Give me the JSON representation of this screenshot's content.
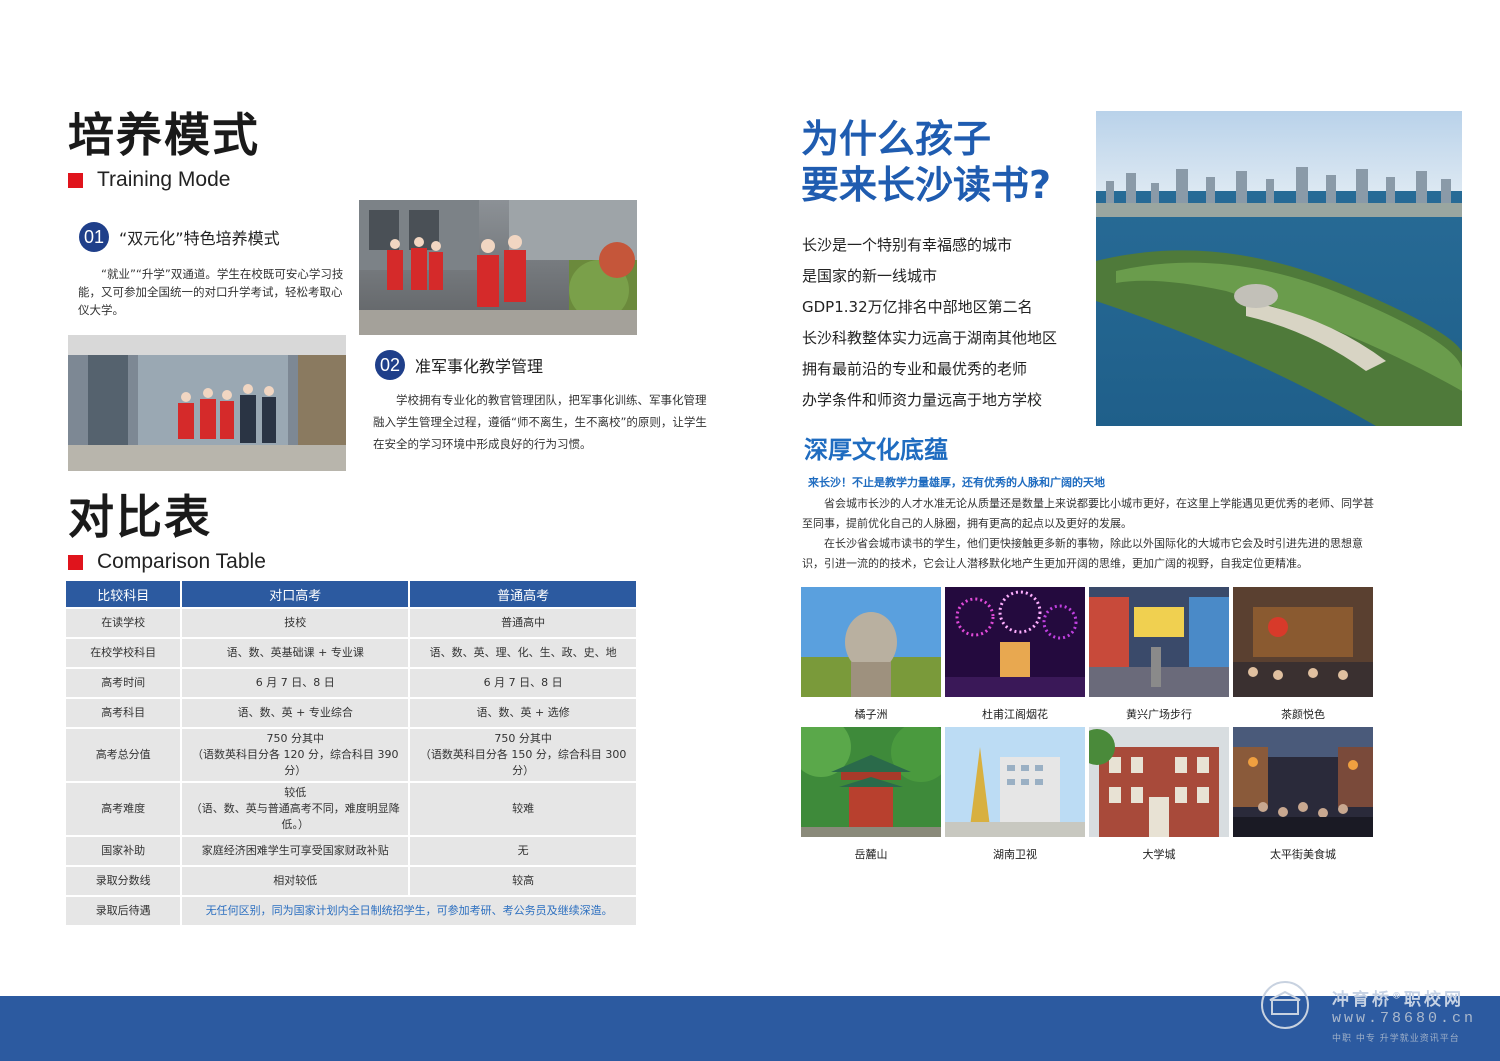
{
  "training": {
    "title": "培养模式",
    "subtitle": "Training Mode",
    "item1": {
      "num": "01",
      "title": "“双元化”特色培养模式",
      "text": "“就业”“升学”双通道。学生在校既可安心学习技能，又可参加全国统一的对口升学考试，轻松考取心仪大学。"
    },
    "item2": {
      "num": "02",
      "title": "准军事化教学管理",
      "text": "学校拥有专业化的教官管理团队，把军事化训练、军事化管理融入学生管理全过程，遵循“师不离生，生不离校”的原则，让学生在安全的学习环境中形成良好的行为习惯。"
    }
  },
  "comparison": {
    "title": "对比表",
    "subtitle": "Comparison Table",
    "headers": [
      "比较科目",
      "对口高考",
      "普通高考"
    ],
    "rows": [
      [
        "在读学校",
        "技校",
        "普通高中"
      ],
      [
        "在校学校科目",
        "语、数、英基础课 + 专业课",
        "语、数、英、理、化、生、政、史、地"
      ],
      [
        "高考时间",
        "6 月 7 日、8 日",
        "6 月 7 日、8 日"
      ],
      [
        "高考科目",
        "语、数、英 + 专业综合",
        "语、数、英 + 选修"
      ],
      [
        "高考总分值",
        "750 分其中\n（语数英科目分各 120 分，综合科目 390 分）",
        "750 分其中\n（语数英科目分各 150 分，综合科目 300 分）"
      ],
      [
        "高考难度",
        "较低\n（语、数、英与普通高考不同，难度明显降低。）",
        "较难"
      ],
      [
        "国家补助",
        "家庭经济困难学生可享受国家财政补贴",
        "无"
      ],
      [
        "录取分数线",
        "相对较低",
        "较高"
      ]
    ],
    "last_row": {
      "label": "录取后待遇",
      "text": "无任何区别，同为国家计划内全日制统招学生，可参加考研、考公务员及继续深造。"
    }
  },
  "why": {
    "title_line1": "为什么孩子",
    "title_line2": "要来长沙读书?",
    "lines": [
      "长沙是一个特别有幸福感的城市",
      "是国家的新一线城市",
      "GDP1.32万亿排名中部地区第二名",
      "长沙科教整体实力远高于湖南其他地区",
      "拥有最前沿的专业和最优秀的老师",
      "办学条件和师资力量远高于地方学校"
    ]
  },
  "culture": {
    "title": "深厚文化底蕴",
    "subtitle": "来长沙！不止是教学力量雄厚，还有优秀的人脉和广阔的天地",
    "para1": "省会城市长沙的人才水准无论从质量还是数量上来说都要比小城市更好，在这里上学能遇见更优秀的老师、同学甚至同事，提前优化自己的人脉圈，拥有更高的起点以及更好的发展。",
    "para2": "在长沙省会城市读书的学生，他们更快接触更多新的事物，除此以外国际化的大城市它会及时引进先进的思想意识，引进一流的的技术，它会让人潜移默化地产生更加开阔的思维，更加广阔的视野，自我定位更精准。"
  },
  "gallery": [
    "橘子洲",
    "杜甫江阁烟花",
    "黄兴广场步行",
    "茶颜悦色",
    "岳麓山",
    "湖南卫视",
    "大学城",
    "太平街美食城"
  ],
  "watermark": {
    "name": "冲育桥",
    "reg": "®",
    "name2": "职校网",
    "url": "www.78680.cn",
    "tagline": "中职 中专 升学就业资讯平台"
  },
  "colors": {
    "navy": "#1f3f8a",
    "blue": "#2c5aa0",
    "title_blue": "#1f5cb0",
    "red": "#e0141c"
  }
}
